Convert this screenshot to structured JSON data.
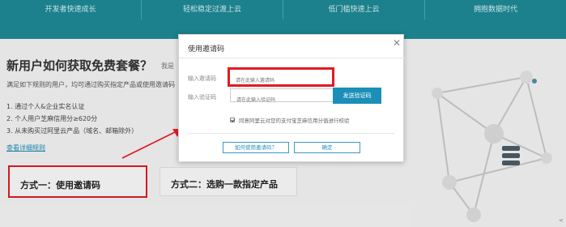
{
  "nav": {
    "items": [
      "开发者快速成长",
      "轻松稳定过渡上云",
      "低门槛快速上云",
      "拥抱数据时代"
    ]
  },
  "content": {
    "title": "新用户如何获取免费套餐？",
    "side_hint": "我是",
    "description": "满足如下规则的用户，均可通过购买指定产品或使用邀请码",
    "rules": [
      "1. 通过个人&企业实名认证",
      "2. 个人用户芝麻信用分≥620分",
      "3. 从未购买过阿里云产品（域名、邮箱除外）"
    ],
    "detail_link": "查看详细规则",
    "method1": "方式一：使用邀请码",
    "method2": "方式二：选购一款指定产品"
  },
  "modal": {
    "title": "使用邀请码",
    "close_icon": "close-icon",
    "code_label": "输入邀请码",
    "code_placeholder": "请在此输入邀请码",
    "verify_label": "输入验证码",
    "verify_placeholder": "请在此输入验证码",
    "send_button": "发送验证码",
    "agree_text": "同意阿里云对您的支付宝芝麻信用分值进行校验",
    "agree_checked": true,
    "how_button": "如何使用邀请码？",
    "ok_button": "确定"
  },
  "colors": {
    "teal_band": "#1e8a96",
    "highlight_red": "#e11b22",
    "accent_blue": "#1b8fb8"
  },
  "corner_mark": "<"
}
